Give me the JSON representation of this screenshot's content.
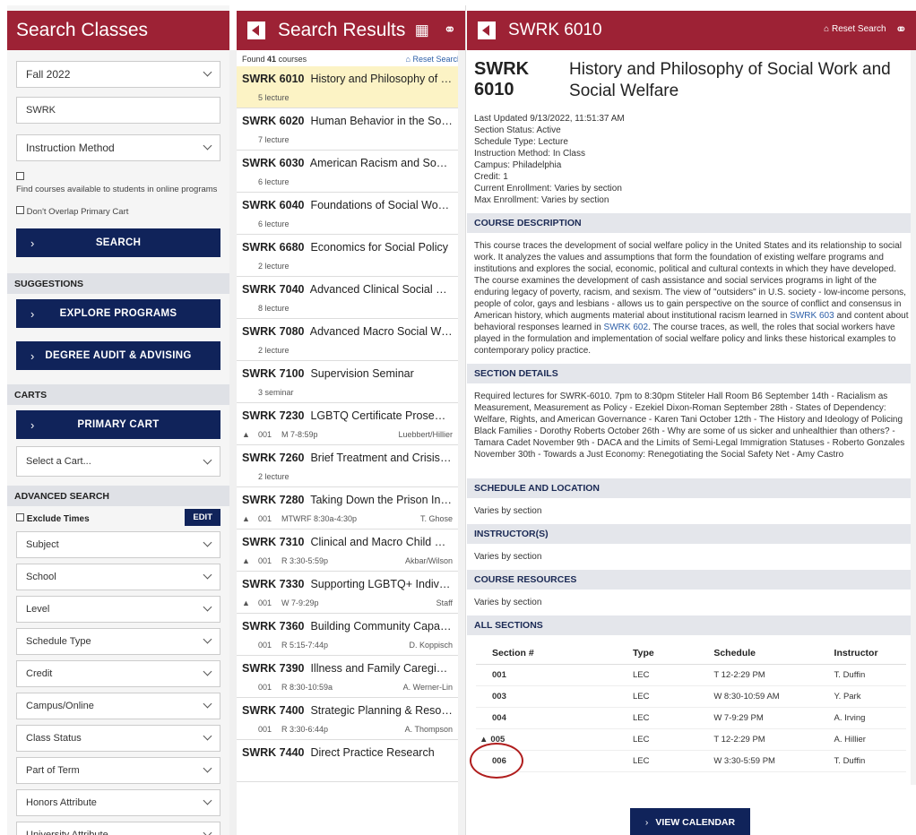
{
  "search_panel": {
    "title": "Search Classes",
    "term_select": "Fall 2022",
    "subject_input": "SWRK",
    "instruction_select": "Instruction Method",
    "online_label": "Find courses available to students in online programs",
    "overlap_label": "Don't Overlap Primary Cart",
    "search_button": "SEARCH",
    "suggestions_header": "SUGGESTIONS",
    "explore_button": "EXPLORE PROGRAMS",
    "degree_button": "DEGREE AUDIT & ADVISING",
    "carts_header": "CARTS",
    "primary_cart_button": "PRIMARY CART",
    "cart_select": "Select a Cart...",
    "advanced_header": "ADVANCED SEARCH",
    "exclude_times": "Exclude Times",
    "edit_button": "EDIT",
    "filters": [
      "Subject",
      "School",
      "Level",
      "Schedule Type",
      "Credit",
      "Campus/Online",
      "Class Status",
      "Part of Term",
      "Honors Attribute",
      "University Attribute"
    ]
  },
  "results_panel": {
    "title": "Search Results",
    "found_prefix": "Found",
    "found_count": "41",
    "found_suffix": "courses",
    "reset": "Reset Search",
    "results": [
      {
        "code": "SWRK 6010",
        "title": "History and Philosophy of So...",
        "sub": "5 lecture"
      },
      {
        "code": "SWRK 6020",
        "title": "Human Behavior in the Social...",
        "sub": "7 lecture"
      },
      {
        "code": "SWRK 6030",
        "title": "American Racism and Social ...",
        "sub": "6 lecture"
      },
      {
        "code": "SWRK 6040",
        "title": "Foundations of Social Work P...",
        "sub": "6 lecture"
      },
      {
        "code": "SWRK 6680",
        "title": "Economics for Social Policy",
        "sub": "2 lecture"
      },
      {
        "code": "SWRK 7040",
        "title": "Advanced Clinical Social Wor...",
        "sub": "8 lecture"
      },
      {
        "code": "SWRK 7080",
        "title": "Advanced Macro Social Work...",
        "sub": "2 lecture"
      },
      {
        "code": "SWRK 7100",
        "title": "Supervision Seminar",
        "sub": "3 seminar"
      },
      {
        "code": "SWRK 7230",
        "title": "LGBTQ Certificate Proseminar",
        "sec": "001",
        "sched": "M 7-8:59p",
        "instr": "Luebbert/Hillier",
        "warn": true
      },
      {
        "code": "SWRK 7260",
        "title": "Brief Treatment and Crisis Int...",
        "sub": "2 lecture"
      },
      {
        "code": "SWRK 7280",
        "title": "Taking Down the Prison Indu...",
        "sec": "001",
        "sched": "MTWRF 8:30a-4:30p",
        "instr": "T. Ghose",
        "warn": true
      },
      {
        "code": "SWRK 7310",
        "title": "Clinical and Macro Child Welf...",
        "sec": "001",
        "sched": "R 3:30-5:59p",
        "instr": "Akbar/Wilson",
        "warn": true
      },
      {
        "code": "SWRK 7330",
        "title": "Supporting LGBTQ+ Individu...",
        "sec": "001",
        "sched": "W 7-9:29p",
        "instr": "Staff",
        "warn": true
      },
      {
        "code": "SWRK 7360",
        "title": "Building Community Capacity",
        "sec": "001",
        "sched": "R 5:15-7:44p",
        "instr": "D. Koppisch",
        "warn": false
      },
      {
        "code": "SWRK 7390",
        "title": "Illness and Family Caregiving",
        "sec": "001",
        "sched": "R 8:30-10:59a",
        "instr": "A. Werner-Lin",
        "warn": false
      },
      {
        "code": "SWRK 7400",
        "title": "Strategic Planning & Resourc...",
        "sec": "001",
        "sched": "R 3:30-6:44p",
        "instr": "A. Thompson",
        "warn": false
      },
      {
        "code": "SWRK 7440",
        "title": "Direct Practice Research",
        "sub": ""
      }
    ]
  },
  "detail_panel": {
    "header": "SWRK 6010",
    "reset": "Reset Search",
    "code": "SWRK 6010",
    "name": "History and Philosophy of Social Work and Social Welfare",
    "meta": [
      "Last Updated 9/13/2022, 11:51:37 AM",
      "Section Status: Active",
      "Schedule Type: Lecture",
      "Instruction Method: In Class",
      "Campus: Philadelphia",
      "Credit: 1",
      "Current Enrollment: Varies by section",
      "Max Enrollment: Varies by section"
    ],
    "desc_header": "COURSE DESCRIPTION",
    "desc_1": "This course traces the development of social welfare policy in the United States and its relationship to social work. It analyzes the values and assumptions that form the foundation of existing welfare programs and institutions and explores the social, economic, political and cultural contexts in which they have developed. The course examines the development of cash assistance and social services programs in light of the enduring legacy of poverty, racism, and sexism. The view of \"outsiders\" in U.S. society - low-income persons, people of color, gays and lesbians - allows us to gain perspective on the source of conflict and consensus in American history, which augments material about institutional racism learned in ",
    "desc_link1": "SWRK 603",
    "desc_2": " and content about behavioral responses learned in ",
    "desc_link2": "SWRK 602",
    "desc_3": ". The course traces, as well, the roles that social workers have played in the formulation and implementation of social welfare policy and links these historical examples to contemporary policy practice.",
    "sec_header": "SECTION DETAILS",
    "sec_text": "Required lectures for SWRK-6010. 7pm to 8:30pm Stiteler Hall Room B6 September 14th - Racialism as Measurement, Measurement as Policy - Ezekiel Dixon-Roman September 28th - States of Dependency: Welfare, Rights, and American Governance - Karen Tani October 12th - The History and Ideology of Policing Black Families - Dorothy Roberts October 26th - Why are some of us sicker and unhealthier than others? - Tamara Cadet November 9th - DACA and the Limits of Semi-Legal Immigration Statuses - Roberto Gonzales November 30th - Towards a Just Economy: Renegotiating the Social Safety Net - Amy Castro",
    "sched_header": "SCHEDULE AND LOCATION",
    "sched_text": "Varies by section",
    "instr_header": "INSTRUCTOR(S)",
    "instr_text": "Varies by section",
    "res_header": "COURSE RESOURCES",
    "res_text": "Varies by section",
    "all_header": "ALL SECTIONS",
    "cols": [
      "Section #",
      "Type",
      "Schedule",
      "Instructor"
    ],
    "sections": [
      {
        "sec": "001",
        "type": "LEC",
        "sched": "T 12-2:29 PM",
        "instr": "T. Duffin",
        "warn": false
      },
      {
        "sec": "003",
        "type": "LEC",
        "sched": "W 8:30-10:59 AM",
        "instr": "Y. Park",
        "warn": false
      },
      {
        "sec": "004",
        "type": "LEC",
        "sched": "W 7-9:29 PM",
        "instr": "A. Irving",
        "warn": false
      },
      {
        "sec": "005",
        "type": "LEC",
        "sched": "T 12-2:29 PM",
        "instr": "A. Hillier",
        "warn": true
      },
      {
        "sec": "006",
        "type": "LEC",
        "sched": "W 3:30-5:59 PM",
        "instr": "T. Duffin",
        "warn": false
      }
    ],
    "calendar_button": "VIEW CALENDAR"
  },
  "colors": {
    "header": "#9d2235",
    "button": "#10235a",
    "selected": "#fcf3c5"
  }
}
